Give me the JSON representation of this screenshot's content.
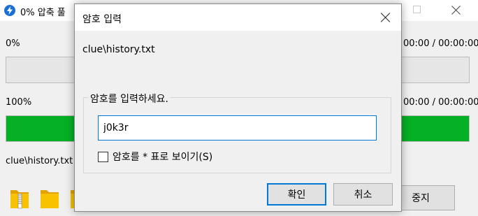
{
  "background_window": {
    "title": "0% 압축 풀",
    "progress_top": {
      "label": "0%",
      "time": "00:00 / 00:00:00",
      "fill_fraction": 0
    },
    "progress_bottom": {
      "label": "100%",
      "time": "00:00 / 00:00:00",
      "fill_fraction": 1.0,
      "fill_color": "#06b025"
    },
    "current_file": "clue\\history.txt",
    "stop_button": "중지"
  },
  "dialog": {
    "title": "암호 입력",
    "file_name": "clue\\history.txt",
    "group_label": "암호를 입력하세요.",
    "password_value": "j0k3r",
    "show_password_label": "암호를 * 표로 보이기(S)",
    "show_password_checked": false,
    "ok_button": "확인",
    "cancel_button": "취소"
  },
  "icons": {
    "app": "lightning-icon",
    "folders": [
      "zip-folder-icon",
      "folder-icon",
      "folder-icon"
    ]
  },
  "colors": {
    "accent": "#0078d7",
    "progress_green": "#06b025"
  }
}
